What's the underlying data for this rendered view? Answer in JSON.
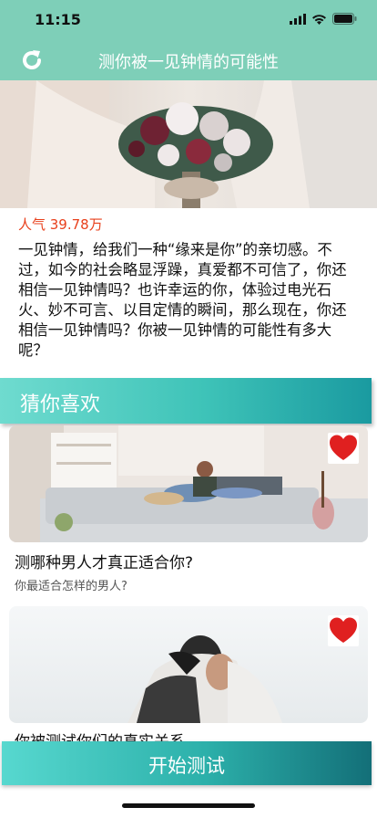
{
  "status_bar": {
    "time": "11:15"
  },
  "nav": {
    "title": "测你被一见钟情的可能性",
    "refresh_icon": "refresh-icon"
  },
  "test": {
    "popularity": "人气 39.78万",
    "description": "一见钟情，给我们一种“缘来是你”的亲切感。不过，如今的社会略显浮躁，真爱都不可信了，你还相信一见钟情吗？也许幸运的你，体验过电光石火、妙不可言、以目定情的瞬间，那么现在，你还相信一见钟情吗？你被一见钟情的可能性有多大呢？"
  },
  "recommend": {
    "section_title": "猜你喜欢",
    "cards": [
      {
        "title": "测哪种男人才真正适合你?",
        "subtitle": "你最适合怎样的男人?"
      },
      {
        "title": "你被测试你们的真实关系",
        "subtitle": ""
      }
    ]
  },
  "bottom": {
    "start_label": "开始测试"
  },
  "colors": {
    "accent": "#7ecfb8",
    "teal": "#2cb0aa",
    "highlight": "#e8401c",
    "heart": "#e02020"
  }
}
